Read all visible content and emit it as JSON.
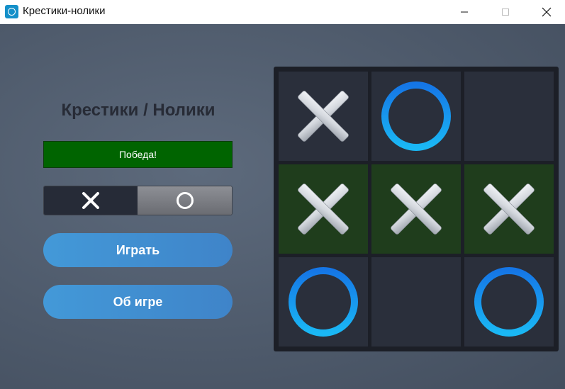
{
  "window": {
    "title": "Крестики-нолики"
  },
  "sidebar": {
    "game_title": "Крестики / Нолики",
    "status_text": "Победа!",
    "play_label": "Играть",
    "about_label": "Об игре",
    "player_toggle": {
      "selected": "X",
      "options": [
        "X",
        "O"
      ]
    }
  },
  "board": {
    "cells": [
      "X",
      "O",
      "",
      "X",
      "X",
      "X",
      "O",
      "",
      "O"
    ],
    "winning_line": [
      3,
      4,
      5
    ]
  },
  "colors": {
    "status_bg": "#006400",
    "button_blue": "#4399d8",
    "ring_blue": "#1aa3f2",
    "win_cell": "#1f3d1c"
  }
}
